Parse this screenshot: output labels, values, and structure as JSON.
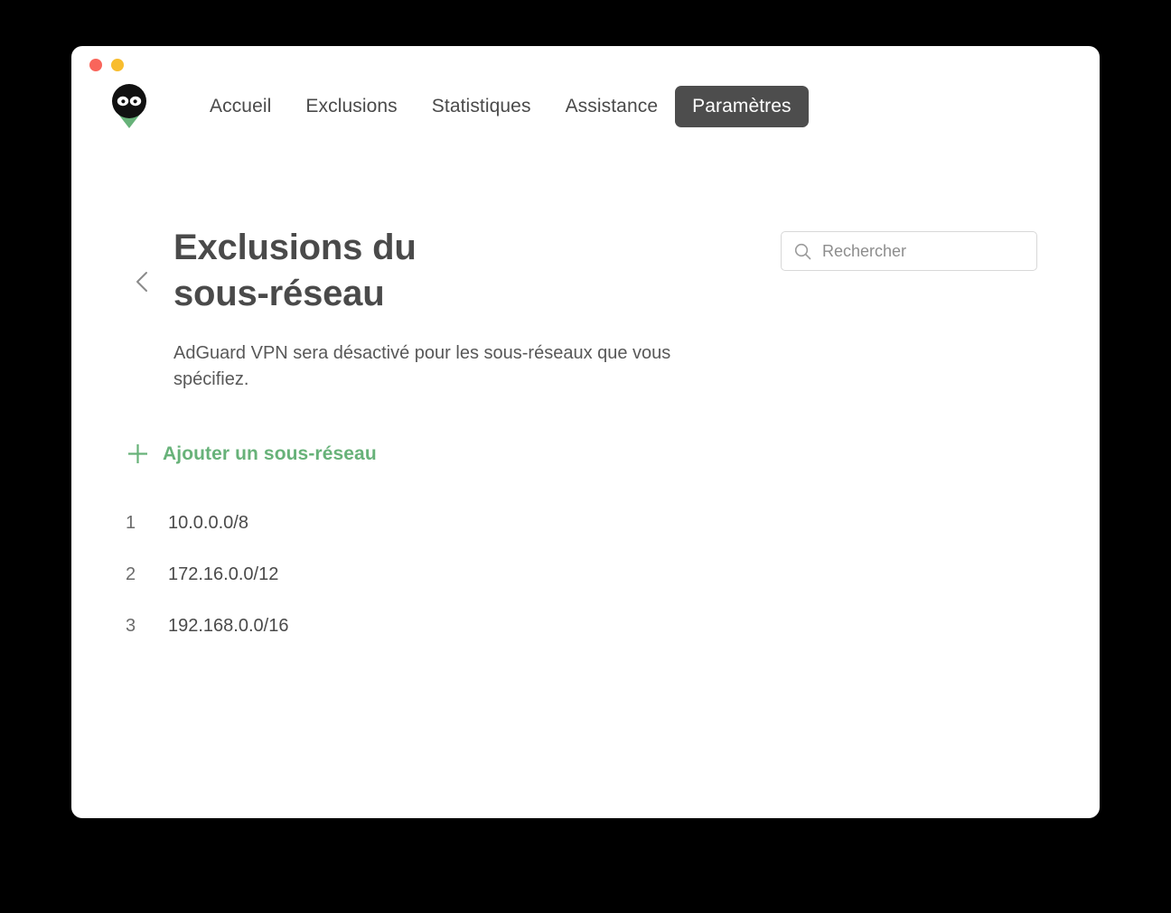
{
  "window": {
    "traffic_lights": [
      {
        "name": "close",
        "color": "#f9655b"
      },
      {
        "name": "minimize",
        "color": "#f8bd2e"
      }
    ]
  },
  "brand": {
    "logo_name": "adguard-vpn-ninja-logo",
    "head_color": "#111111",
    "shield_color": "#67b279"
  },
  "nav": {
    "items": [
      {
        "label": "Accueil",
        "active": false
      },
      {
        "label": "Exclusions",
        "active": false
      },
      {
        "label": "Statistiques",
        "active": false
      },
      {
        "label": "Assistance",
        "active": false
      },
      {
        "label": "Paramètres",
        "active": true
      }
    ],
    "active_bg": "#4d4d4d",
    "active_fg": "#ffffff",
    "inactive_fg": "#4a4a4a"
  },
  "page": {
    "back_icon": "chevron-left-icon",
    "title": "Exclusions du sous-réseau",
    "description": "AdGuard VPN sera désactivé pour les sous-réseaux que vous spécifiez."
  },
  "search": {
    "icon": "search-icon",
    "placeholder": "Rechercher",
    "value": ""
  },
  "add_action": {
    "icon": "plus-icon",
    "label": "Ajouter un sous-réseau",
    "color": "#67b279"
  },
  "subnets": [
    {
      "index": "1",
      "value": "10.0.0.0/8"
    },
    {
      "index": "2",
      "value": "172.16.0.0/12"
    },
    {
      "index": "3",
      "value": "192.168.0.0/16"
    }
  ]
}
